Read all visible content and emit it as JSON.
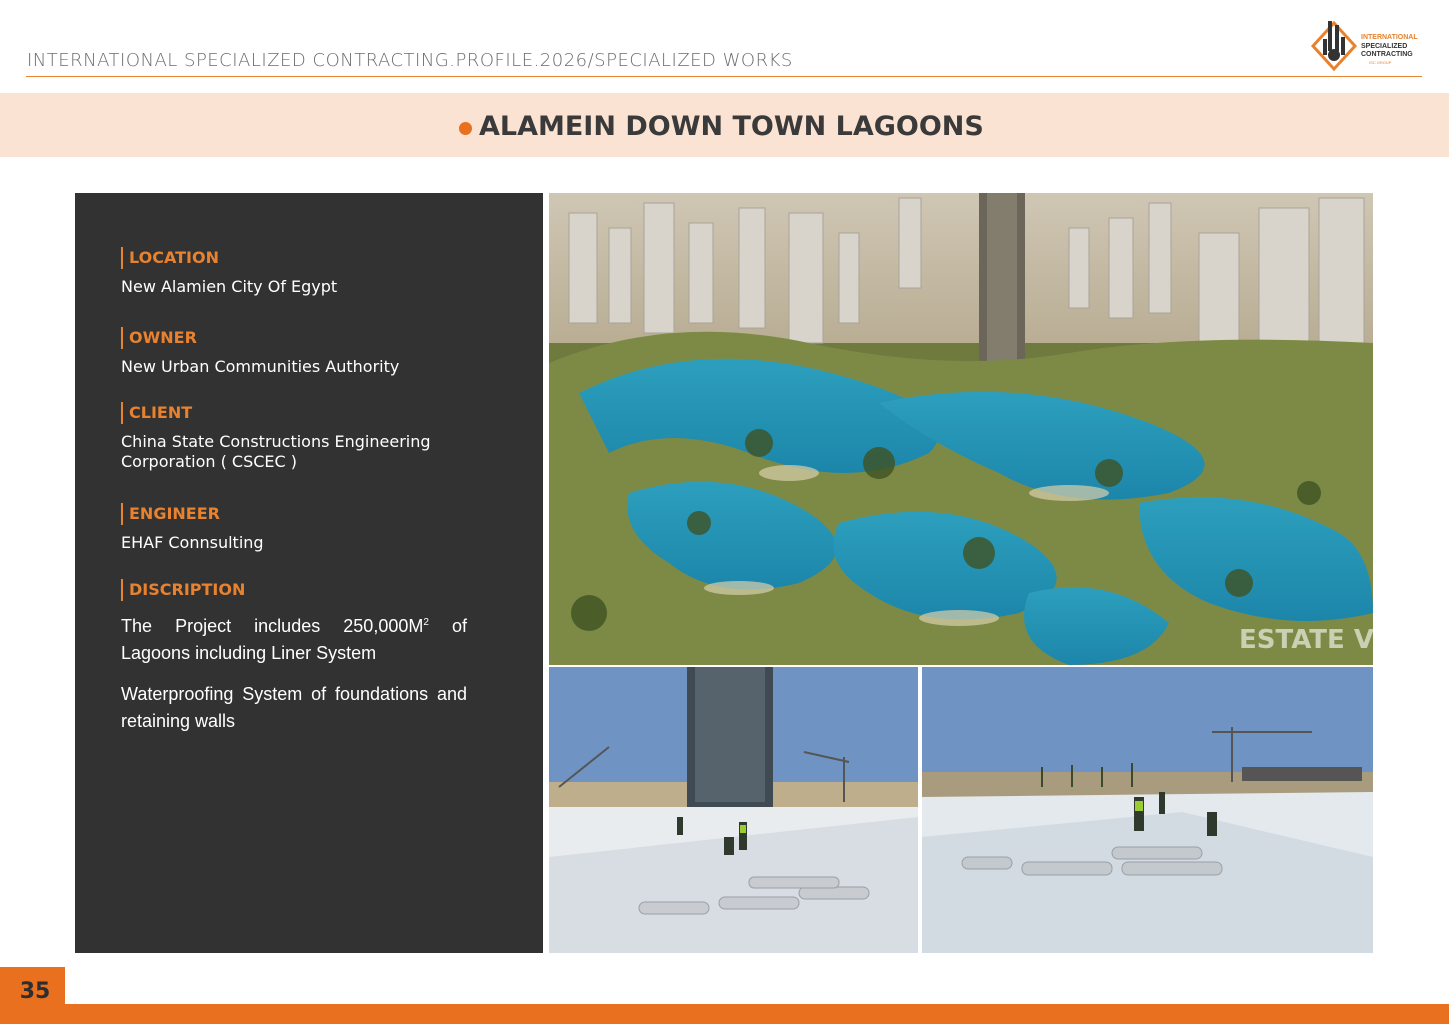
{
  "header": {
    "title": "INTERNATIONAL SPECIALIZED CONTRACTING.PROFILE.2026/SPECIALIZED WORKS",
    "logo_lines": [
      "INTERNATIONAL",
      "SPECIALIZED",
      "CONTRACTING",
      "ISC GROUP"
    ]
  },
  "project": {
    "title": "ALAMEIN DOWN TOWN LAGOONS"
  },
  "details": {
    "location": {
      "label": "LOCATION",
      "value": "New Alamien City Of Egypt"
    },
    "owner": {
      "label": "OWNER",
      "value": "New Urban Communities Authority"
    },
    "client": {
      "label": "CLIENT",
      "value": "China State Constructions Engineering Corporation ( CSCEC )"
    },
    "engineer": {
      "label": "ENGINEER",
      "value": "EHAF Connsulting"
    },
    "description": {
      "label": "DISCRIPTION",
      "line1_pre": "The Project includes 250,000M",
      "line1_sup": "2",
      "line1_post": " of Lagoons including Liner System",
      "line2": "Waterproofing System of foundations and retaining walls"
    }
  },
  "images": {
    "main_watermark": "ESTATE VIEW"
  },
  "footer": {
    "page_number": "35"
  },
  "colors": {
    "accent": "#e8701e",
    "panel": "#323232",
    "band": "#fbe3d3"
  }
}
